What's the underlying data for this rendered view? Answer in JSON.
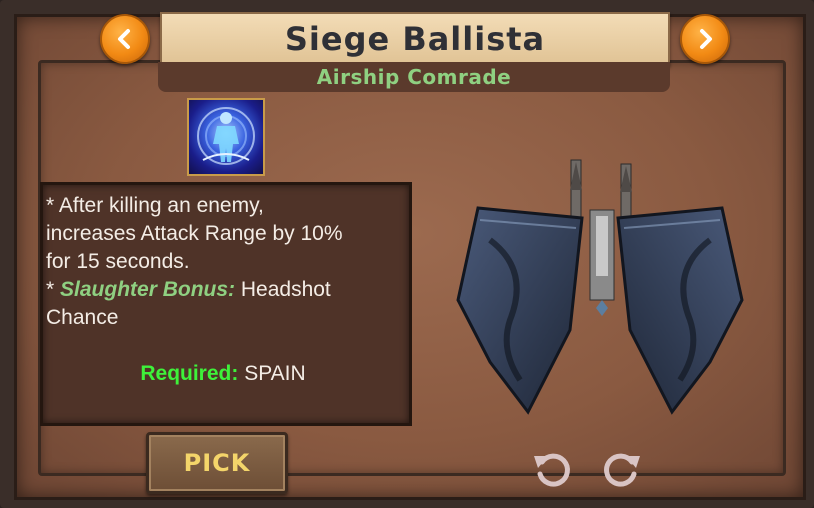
{
  "header": {
    "title": "Siege Ballista",
    "subtitle": "Airship Comrade"
  },
  "skill": {
    "icon": "warrior-aura-icon",
    "description_line1": "* After killing an enemy,",
    "description_line2": "increases Attack Range by 10%",
    "description_line3": "for 15 seconds.",
    "bonus_prefix": "* ",
    "bonus_label": "Slaughter Bonus:",
    "bonus_value": " Headshot",
    "bonus_value_line2": "Chance"
  },
  "requirement": {
    "label": "Required:",
    "value": " SPAIN"
  },
  "actions": {
    "pick_label": "PICK"
  },
  "icons": {
    "prev": "chevron-left-icon",
    "next": "chevron-right-icon",
    "rotate_left": "rotate-left-icon",
    "rotate_right": "rotate-right-icon"
  },
  "colors": {
    "accent_orange": "#f28a14",
    "subtitle_green": "#8fd081",
    "required_green": "#3ef13a",
    "pick_text": "#f4d56a"
  }
}
